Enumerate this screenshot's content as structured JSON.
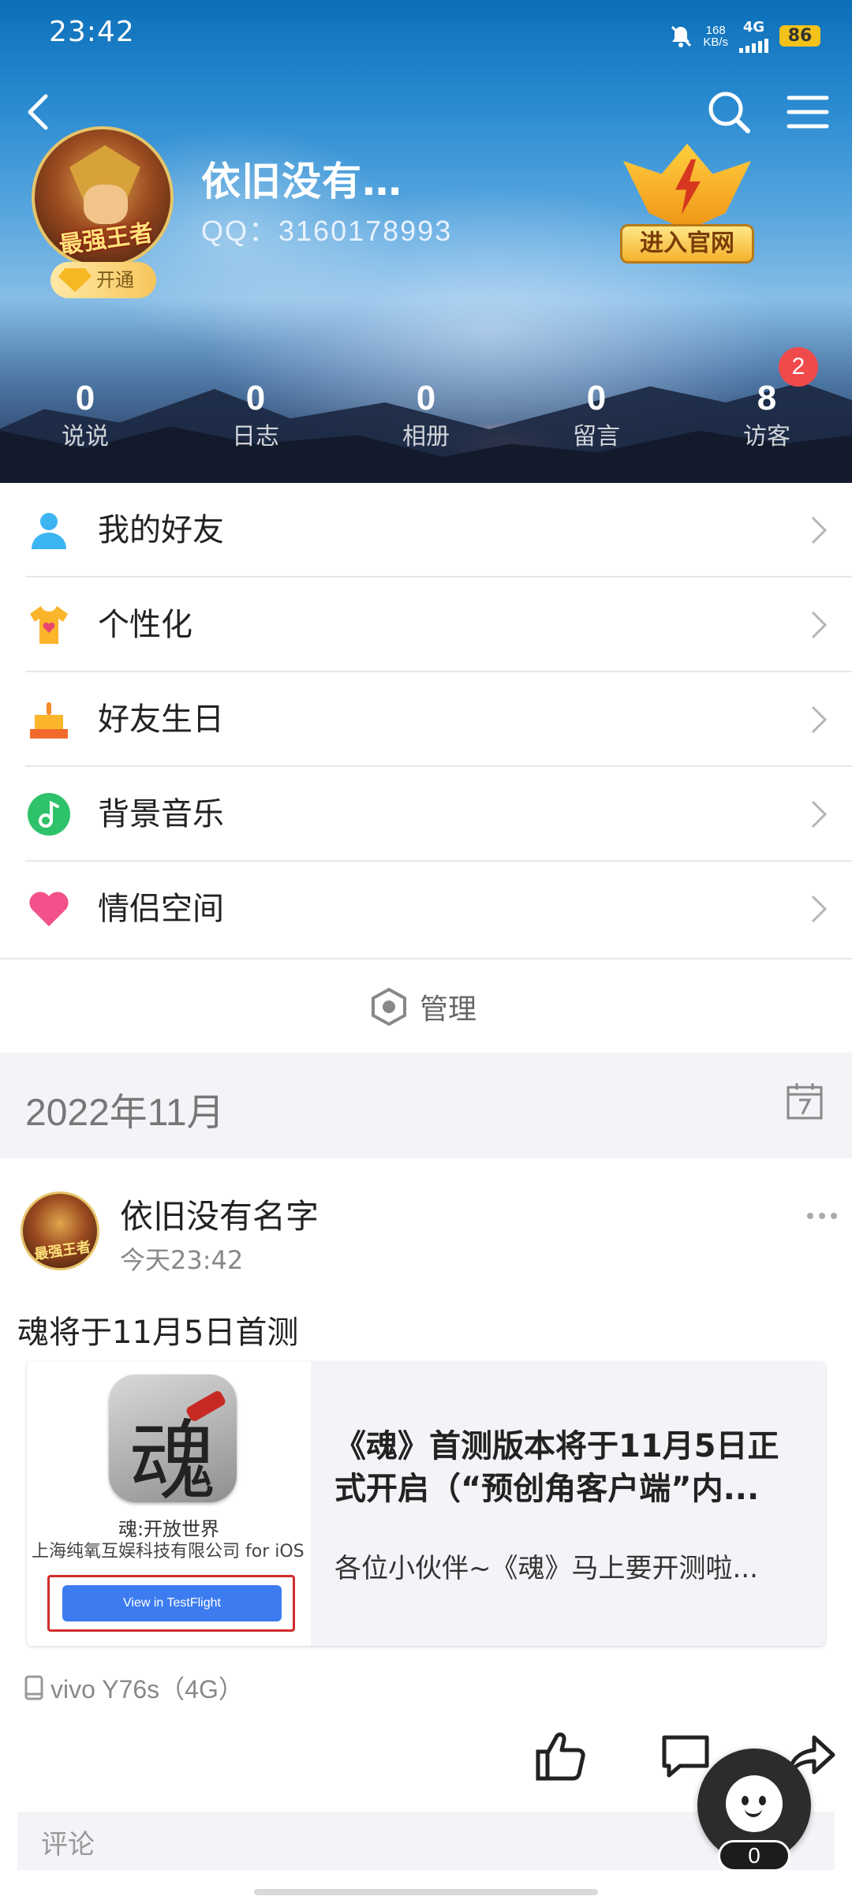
{
  "status_bar": {
    "time": "23:42",
    "speed_value": "168",
    "speed_unit": "KB/s",
    "network": "4G",
    "battery": "86"
  },
  "profile": {
    "nickname": "依旧没有…",
    "qq": "QQ：3160178993",
    "avatar_stamp": "最强王者",
    "vip_label": "开通",
    "official_label": "进入官网"
  },
  "stats": [
    {
      "value": "0",
      "label": "说说"
    },
    {
      "value": "0",
      "label": "日志"
    },
    {
      "value": "0",
      "label": "相册"
    },
    {
      "value": "0",
      "label": "留言"
    },
    {
      "value": "8",
      "label": "访客"
    }
  ],
  "visitor_badge": "2",
  "menu": [
    {
      "label": "我的好友",
      "icon": "friends-icon"
    },
    {
      "label": "个性化",
      "icon": "tshirt-icon"
    },
    {
      "label": "好友生日",
      "icon": "cake-icon"
    },
    {
      "label": "背景音乐",
      "icon": "music-icon"
    },
    {
      "label": "情侣空间",
      "icon": "heart-icon"
    }
  ],
  "manage_label": "管理",
  "month_label": "2022年11月",
  "post": {
    "author": "依旧没有名字",
    "time": "今天23:42",
    "avatar_stamp": "最强王者",
    "text": "魂将于11月5日首测",
    "card": {
      "app_glyph": "魂",
      "app_name": "魂:开放世界",
      "developer": "上海纯氧互娱科技有限公司 for iOS",
      "button": "View in TestFlight",
      "title": "《魂》首测版本将于11月5日正式开启（“预创角客户端”内...",
      "desc": "各位小伙伴~《魂》马上要开测啦..."
    },
    "device": "vivo  Y76s（4G）"
  },
  "comment_placeholder": "评论",
  "fab_count": "0",
  "colors": {
    "badge": "#f04a4a",
    "testflight_button": "#3d7cf0",
    "highlight_box": "#d02c2c",
    "vip_gold": "#f7c65a"
  }
}
